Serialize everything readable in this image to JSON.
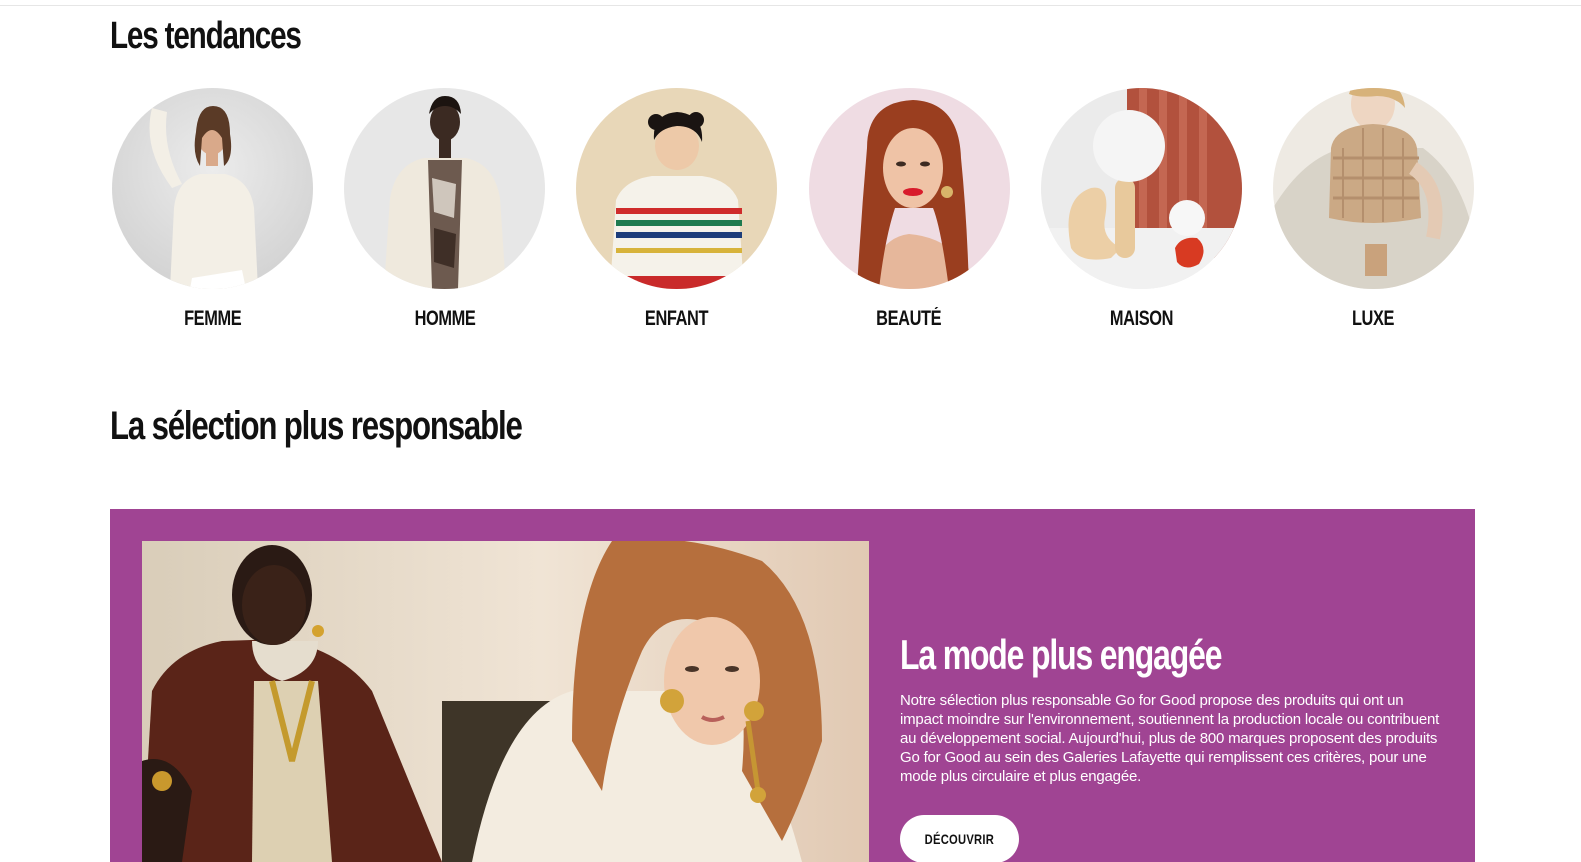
{
  "trends": {
    "title": "Les tendances",
    "categories": [
      {
        "label": "FEMME",
        "image": "woman-in-cream-sweater"
      },
      {
        "label": "HOMME",
        "image": "man-in-cream-jacket"
      },
      {
        "label": "ENFANT",
        "image": "child-in-striped-sweater"
      },
      {
        "label": "BEAUTÉ",
        "image": "woman-red-lips-portrait"
      },
      {
        "label": "MAISON",
        "image": "sculptural-lamp-decor"
      },
      {
        "label": "LUXE",
        "image": "woman-with-quilted-handbag"
      }
    ]
  },
  "selection": {
    "title": "La sélection plus responsable"
  },
  "banner": {
    "heading": "La mode plus engagée",
    "body": "Notre sélection plus responsable Go for Good propose des produits qui ont un impact moindre sur l'environnement, soutiennent la production locale ou contribuent au développement social. Aujourd'hui, plus de 800 marques proposent des produits Go for Good au sein des Galeries Lafayette qui remplissent ces critères, pour une mode plus circulaire et plus engagée.",
    "cta_label": "DÉCOUVRIR",
    "background_color": "#a04493",
    "image": "two-models-wearing-gold-jewelry"
  }
}
